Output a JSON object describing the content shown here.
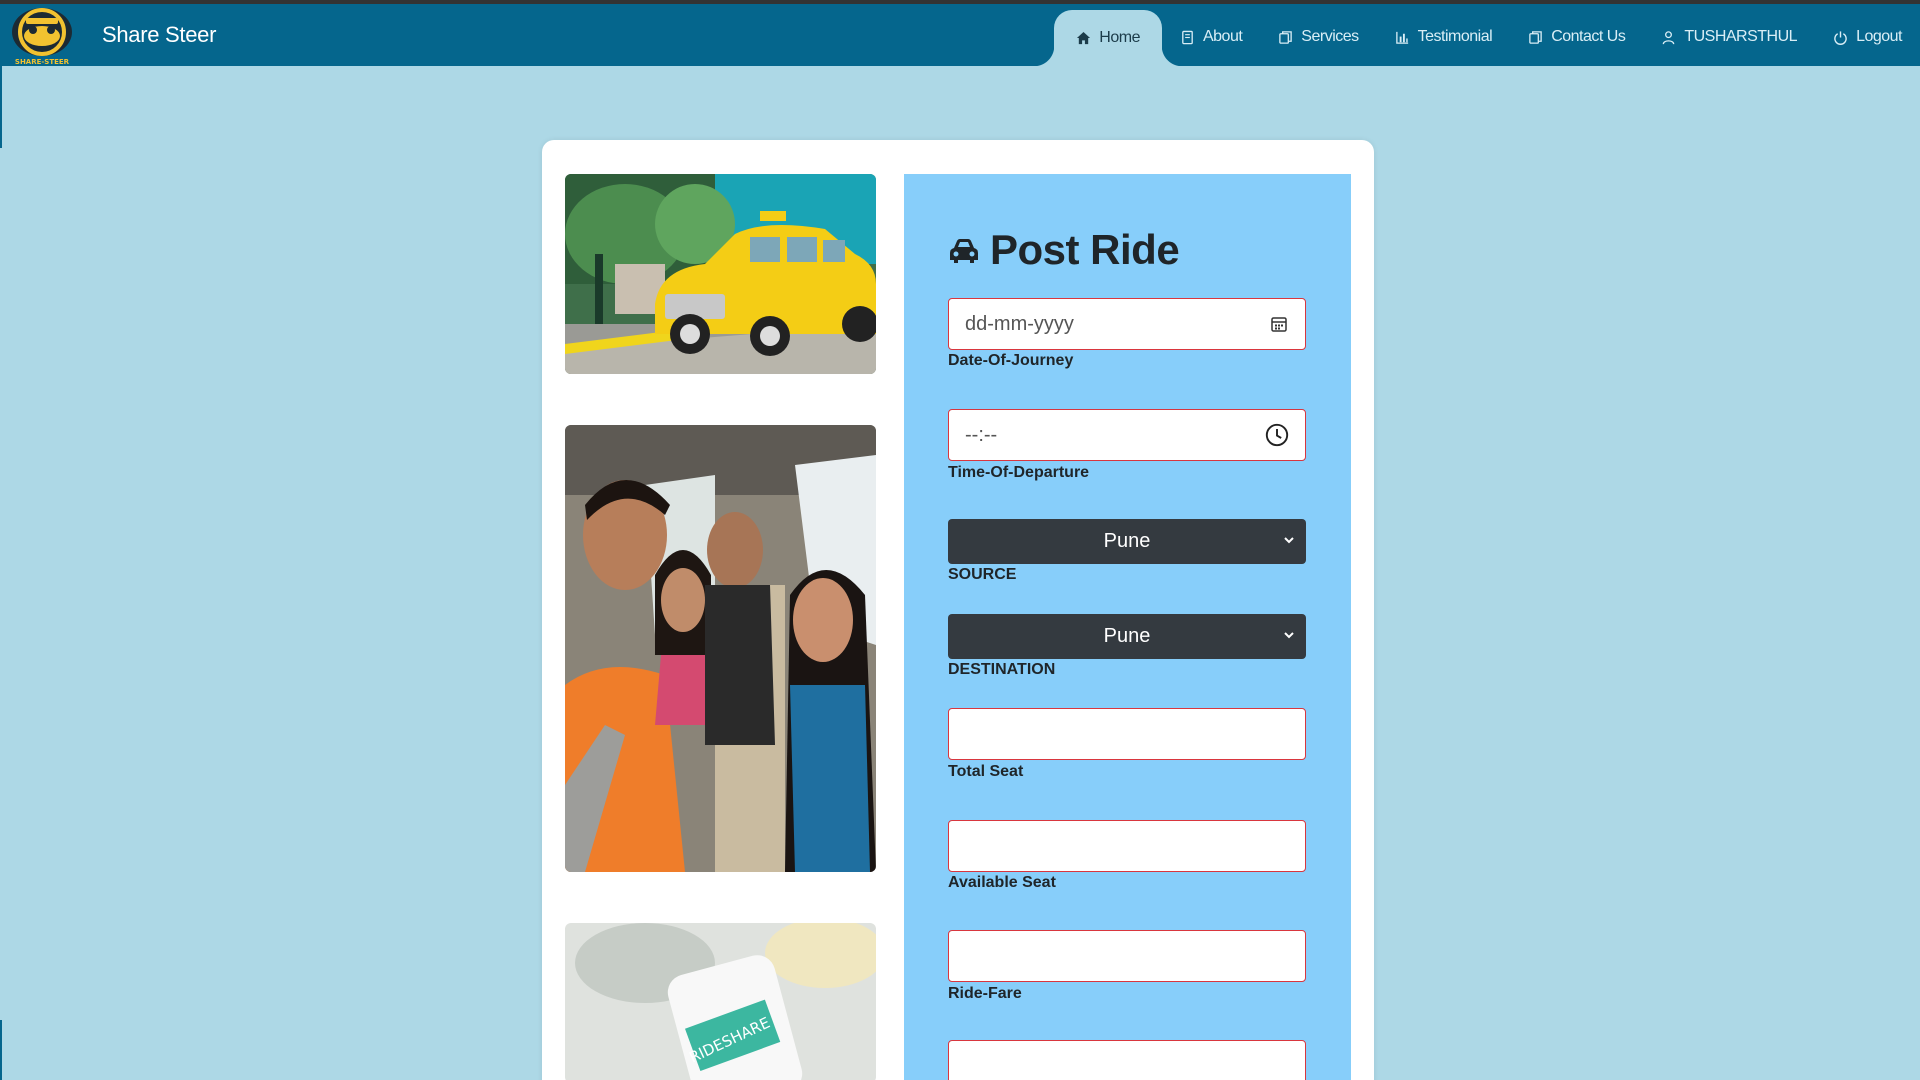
{
  "brand": {
    "name": "Share Steer",
    "logo_text": "SHARE-STEER"
  },
  "nav": [
    {
      "label": "Home",
      "icon": "home-icon",
      "active": true
    },
    {
      "label": "About",
      "icon": "book-icon"
    },
    {
      "label": "Services",
      "icon": "copy-icon"
    },
    {
      "label": "Testimonial",
      "icon": "bar-chart-icon"
    },
    {
      "label": "Contact Us",
      "icon": "copy-icon"
    },
    {
      "label": "TUSHARSTHUL",
      "icon": "user-icon"
    },
    {
      "label": "Logout",
      "icon": "power-icon"
    }
  ],
  "form": {
    "title": "Post Ride",
    "date_placeholder": "dd-mm-yyyy",
    "date_label": "Date-Of-Journey",
    "time_placeholder": "--:--",
    "time_label": "Time-Of-Departure",
    "source_value": "Pune",
    "source_label": "SOURCE",
    "destination_value": "Pune",
    "destination_label": "DESTINATION",
    "total_seat_label": "Total Seat",
    "available_seat_label": "Available Seat",
    "ride_fare_label": "Ride-Fare"
  },
  "images": {
    "img3_text": "RIDESHARE"
  },
  "colors": {
    "navbar": "#05668d",
    "background": "#add8e6",
    "form_panel": "#87cefa",
    "field_border": "#d9363e",
    "select_bg": "#343a40"
  }
}
